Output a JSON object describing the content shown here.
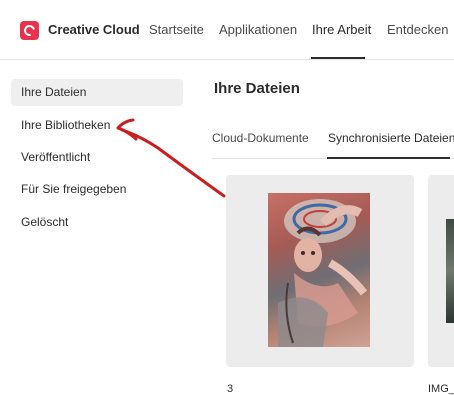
{
  "header": {
    "brand": "Creative Cloud",
    "nav": [
      "Startseite",
      "Applikationen",
      "Ihre Arbeit",
      "Entdecken"
    ],
    "active_nav": "Ihre Arbeit"
  },
  "sidebar": {
    "items": [
      {
        "label": "Ihre Dateien",
        "active": true
      },
      {
        "label": "Ihre Bibliotheken",
        "active": false
      },
      {
        "label": "Veröffentlicht",
        "active": false
      },
      {
        "label": "Für Sie freigegeben",
        "active": false
      },
      {
        "label": "Gelöscht",
        "active": false
      }
    ]
  },
  "main": {
    "title": "Ihre Dateien",
    "tabs": [
      {
        "label": "Cloud-Dokumente",
        "active": false
      },
      {
        "label": "Synchronisierte Dateien",
        "active": true
      }
    ],
    "files": [
      {
        "name": "3"
      },
      {
        "name": "IMG_"
      }
    ]
  },
  "colors": {
    "brand_red": "#e8334f",
    "annotation_red": "#c91f1f",
    "card_bg": "#ececec",
    "active_bg": "#efefef"
  },
  "icons": {
    "logo": "creative-cloud-logo-icon"
  }
}
